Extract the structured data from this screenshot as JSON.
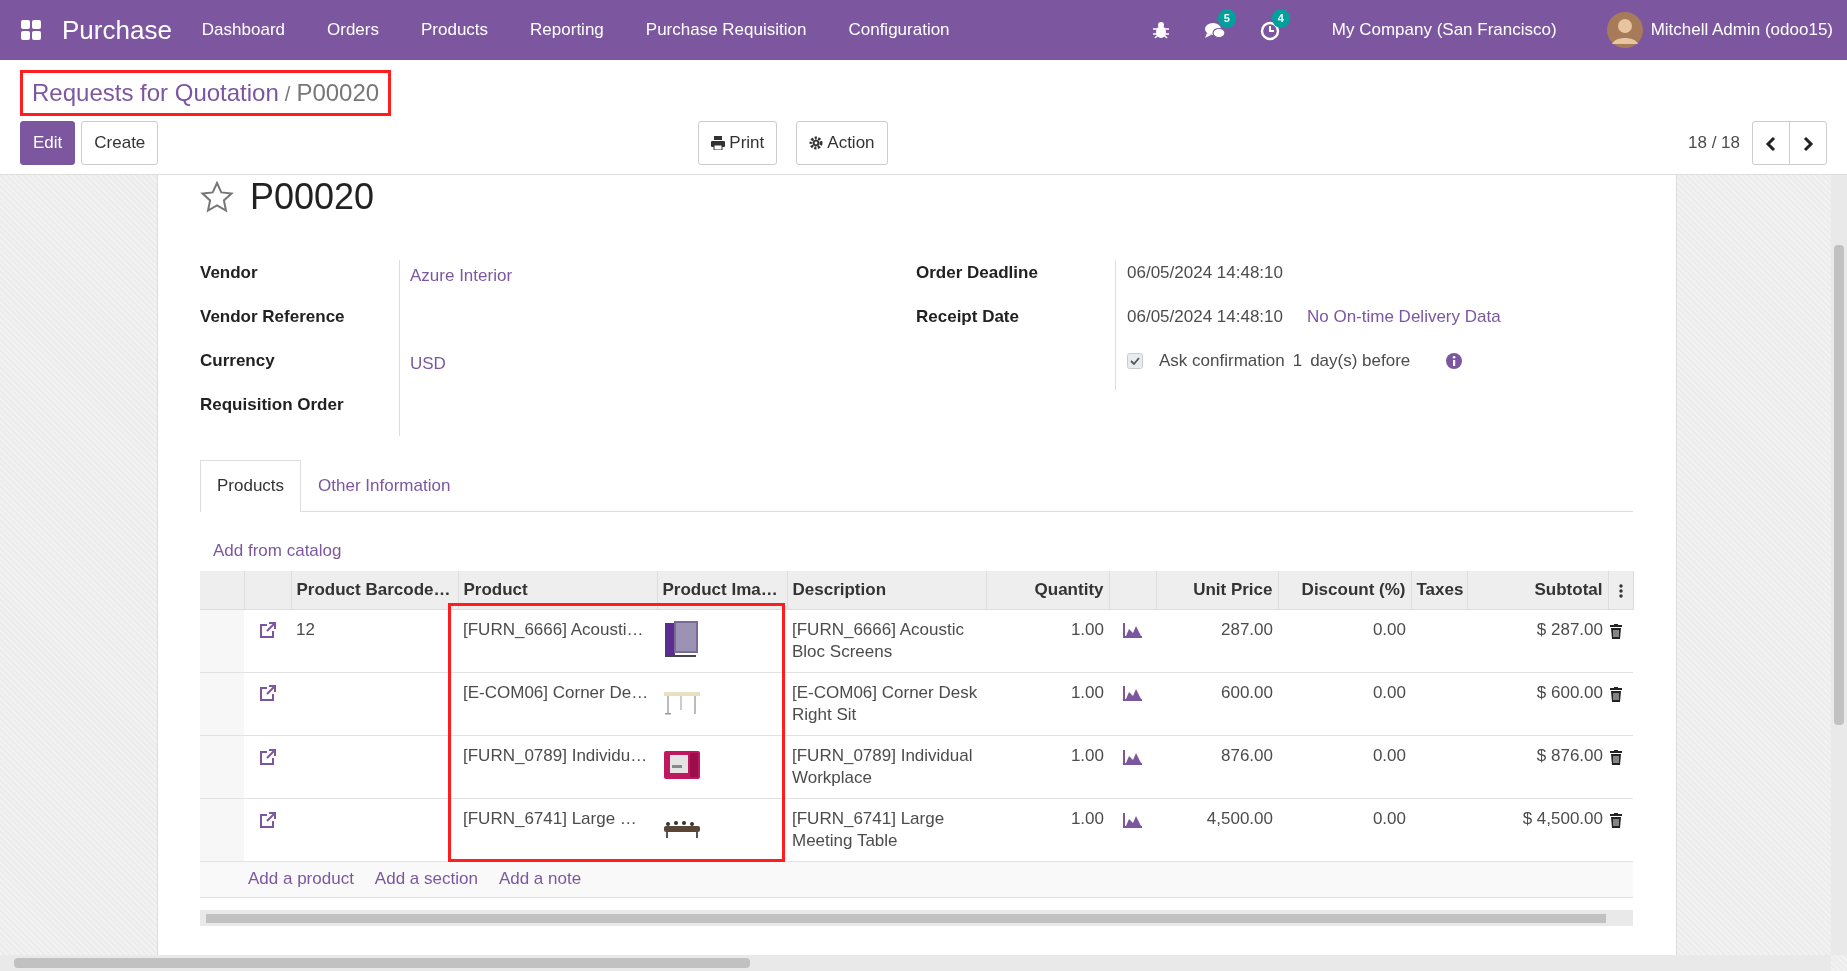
{
  "navbar": {
    "app": "Purchase",
    "menu": [
      "Dashboard",
      "Orders",
      "Products",
      "Reporting",
      "Purchase Requisition",
      "Configuration"
    ],
    "messages_badge": "5",
    "activities_badge": "4",
    "company": "My Company (San Francisco)",
    "user": "Mitchell Admin (odoo15)"
  },
  "breadcrumb": {
    "parent": "Requests for Quotation",
    "separator": "/",
    "current": "P00020",
    "highlighted": true
  },
  "buttons": {
    "edit": "Edit",
    "create": "Create",
    "print": "Print",
    "action": "Action"
  },
  "pager": "18 / 18",
  "record": {
    "title": "P00020",
    "starred": false
  },
  "fields_left": [
    {
      "label": "Vendor",
      "value": "Azure Interior"
    },
    {
      "label": "Vendor Reference"
    },
    {
      "label": "Currency",
      "value": "USD"
    },
    {
      "label": "Requisition Order"
    }
  ],
  "fields_right": [
    {
      "label": "Order Deadline",
      "value": "06/05/2024 14:48:10"
    },
    {
      "label": "Receipt Date",
      "value": "06/05/2024 14:48:10",
      "link": "No On-time Delivery Data"
    }
  ],
  "ask_confirmation": {
    "checked": true,
    "text_before": "Ask confirmation",
    "days": "1",
    "text_after": "day(s) before"
  },
  "tabs": [
    {
      "label": "Products",
      "selected": true
    },
    {
      "label": "Other Information",
      "selected": false
    }
  ],
  "add_from_catalog": "Add from catalog",
  "table": {
    "columns": [
      "Product Barcode…",
      "Product",
      "Product Ima…",
      "Description",
      "Quantity",
      "Unit Price",
      "Discount (%)",
      "Taxes",
      "Subtotal"
    ],
    "product_column_highlighted": true,
    "rows": [
      {
        "barcode": "12",
        "product": "[FURN_6666] Acousti…",
        "description": "[FURN_6666] Acoustic Bloc Screens",
        "quantity": "1.00",
        "unit_price": "287.00",
        "discount": "0.00",
        "subtotal": "$ 287.00"
      },
      {
        "product": "[E-COM06] Corner De…",
        "description": "[E-COM06] Corner Desk Right Sit",
        "quantity": "1.00",
        "unit_price": "600.00",
        "discount": "0.00",
        "subtotal": "$ 600.00"
      },
      {
        "product": "[FURN_0789] Individu…",
        "description": "[FURN_0789] Individual Workplace",
        "quantity": "1.00",
        "unit_price": "876.00",
        "discount": "0.00",
        "subtotal": "$ 876.00"
      },
      {
        "product": "[FURN_6741] Large …",
        "description": "[FURN_6741] Large Meeting Table",
        "quantity": "1.00",
        "unit_price": "4,500.00",
        "discount": "0.00",
        "subtotal": "$ 4,500.00"
      }
    ],
    "footer_links": [
      "Add a product",
      "Add a section",
      "Add a note"
    ]
  }
}
